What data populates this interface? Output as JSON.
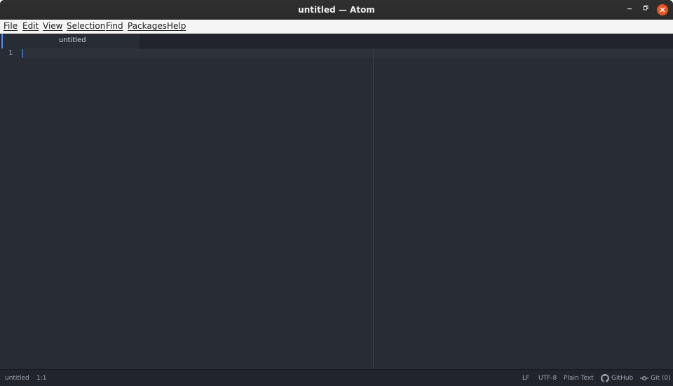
{
  "window": {
    "title": "untitled — Atom",
    "minimize_glyph": "–",
    "maximize_glyph": "▫",
    "close_glyph": "✕"
  },
  "menu": {
    "items": [
      "File",
      "Edit",
      "View",
      "Selection",
      "Find",
      "Packages",
      "Help"
    ]
  },
  "tabs": [
    {
      "label": "untitled",
      "active": true
    }
  ],
  "editor": {
    "line_numbers": [
      "1"
    ],
    "content": ""
  },
  "statusbar": {
    "file_name": "untitled",
    "cursor_position": "1:1",
    "line_ending": "LF",
    "encoding": "UTF-8",
    "grammar": "Plain Text",
    "github_label": "GitHub",
    "git_label": "Git (0)"
  },
  "colors": {
    "accent": "#568af2",
    "close_button": "#e95420",
    "editor_bg": "#282c34",
    "chrome_bg": "#21252b"
  },
  "icons": {
    "github": "github-icon",
    "git": "git-commit-icon"
  }
}
